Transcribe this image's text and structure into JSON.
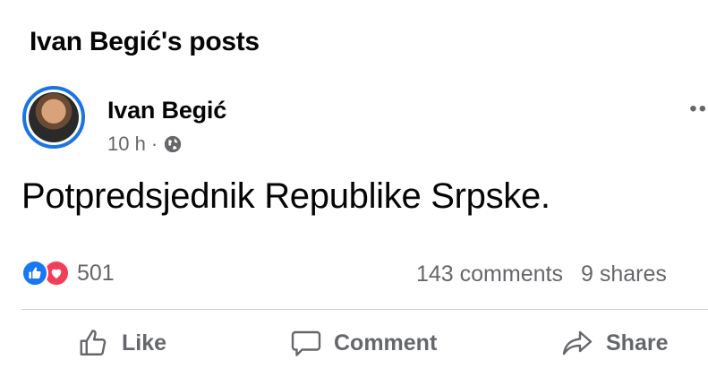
{
  "header": {
    "title": "Ivan Begić's posts"
  },
  "post": {
    "author": "Ivan Begić",
    "time": "10 h",
    "separator": "·",
    "audience_icon": "globe-icon",
    "text": "Potpredsjednik Republike Srpske.",
    "more_icon": "more-icon"
  },
  "stats": {
    "reactions_count": "501",
    "comments": "143 comments",
    "shares": "9 shares"
  },
  "actions": {
    "like": "Like",
    "comment": "Comment",
    "share": "Share"
  },
  "colors": {
    "accent": "#1b74e4",
    "secondary_text": "#65676b",
    "love": "#f33e58"
  }
}
